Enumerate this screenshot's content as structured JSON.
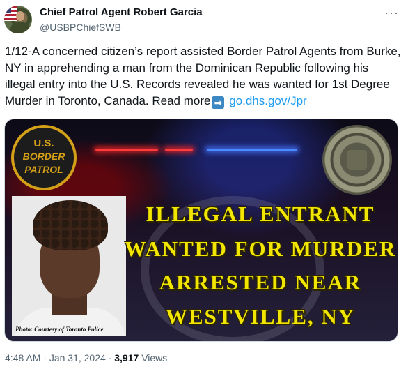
{
  "author": {
    "name": "Chief Patrol Agent Robert Garcia",
    "handle": "@USBPChiefSWB"
  },
  "more_icon": "···",
  "tweet": {
    "text": "1/12-A concerned citizen’s report assisted Border Patrol Agents from Burke, NY in apprehending a man from the Dominican Republic following his illegal entry into the U.S. Records revealed he was wanted for 1st Degree Murder in Toronto, Canada. Read more",
    "arrow": "➡",
    "link_text": "go.dhs.gov/Jpr"
  },
  "media": {
    "patch": {
      "line1": "U.S.",
      "line2": "BORDER",
      "line3": "PATROL"
    },
    "headline": [
      "ILLEGAL ENTRANT",
      "WANTED FOR MURDER",
      "ARRESTED NEAR",
      "WESTVILLE, NY"
    ],
    "photo_caption": "Photo: Courtesy of Toronto Police"
  },
  "meta": {
    "time": "4:48 AM",
    "separator": "·",
    "date": "Jan 31, 2024",
    "views_count": "3,917",
    "views_label": "Views"
  }
}
